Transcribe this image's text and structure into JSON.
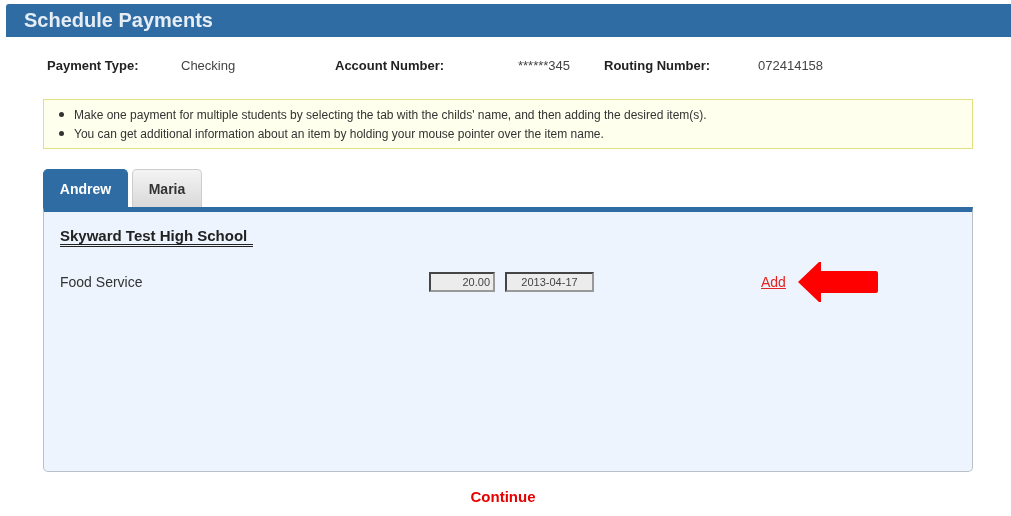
{
  "header": {
    "title": "Schedule Payments"
  },
  "account_info": [
    {
      "label": "Payment Type:",
      "value": "Checking"
    },
    {
      "label": "Account Number:",
      "value": "******345"
    },
    {
      "label": "Routing Number:",
      "value": "072414158"
    }
  ],
  "notes": [
    "Make one payment for multiple students by selecting the tab with the childs' name, and then adding the desired item(s).",
    "You can get additional information about an item by holding your mouse pointer over the item name."
  ],
  "tabs": [
    {
      "label": "Andrew",
      "selected": true
    },
    {
      "label": "Maria",
      "selected": false
    }
  ],
  "school": "Skyward Test High School",
  "items": [
    {
      "name": "Food Service",
      "amount": "20.00",
      "date": "2013-04-17",
      "link": "Add"
    }
  ],
  "continue": "Continue"
}
